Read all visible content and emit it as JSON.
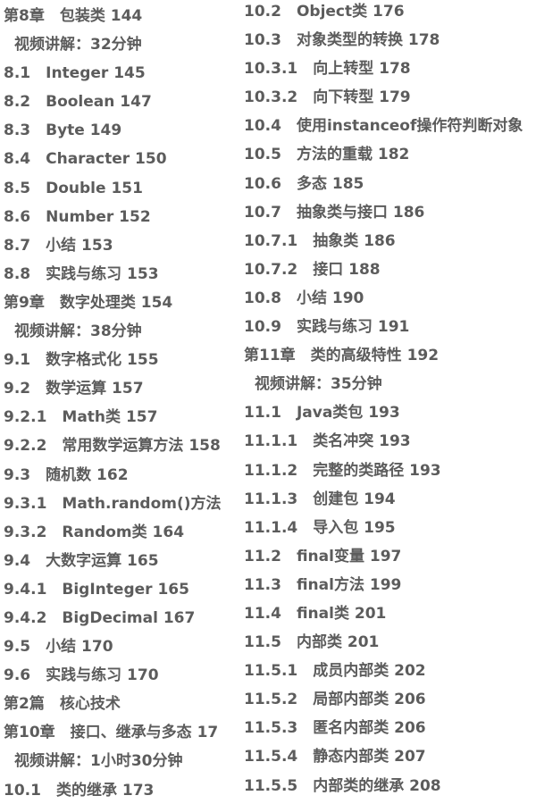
{
  "left_column": [
    {
      "text": "第8章　包装类 144",
      "indent": false
    },
    {
      "text": "视频讲解：32分钟",
      "indent": true
    },
    {
      "text": "8.1　Integer 145",
      "indent": false
    },
    {
      "text": "8.2　Boolean 147",
      "indent": false
    },
    {
      "text": "8.3　Byte 149",
      "indent": false
    },
    {
      "text": "8.4　Character 150",
      "indent": false
    },
    {
      "text": "8.5　Double 151",
      "indent": false
    },
    {
      "text": "8.6　Number 152",
      "indent": false
    },
    {
      "text": "8.7　小结 153",
      "indent": false
    },
    {
      "text": "8.8　实践与练习 153",
      "indent": false
    },
    {
      "text": "第9章　数字处理类 154",
      "indent": false
    },
    {
      "text": "视频讲解：38分钟",
      "indent": true
    },
    {
      "text": "9.1　数字格式化 155",
      "indent": false
    },
    {
      "text": "9.2　数学运算 157",
      "indent": false
    },
    {
      "text": "9.2.1　Math类 157",
      "indent": false
    },
    {
      "text": "9.2.2　常用数学运算方法 158",
      "indent": false
    },
    {
      "text": "9.3　随机数 162",
      "indent": false
    },
    {
      "text": "9.3.1　Math.random()方法",
      "indent": false
    },
    {
      "text": "9.3.2　Random类 164",
      "indent": false
    },
    {
      "text": "9.4　大数字运算 165",
      "indent": false
    },
    {
      "text": "9.4.1　BigInteger 165",
      "indent": false
    },
    {
      "text": "9.4.2　BigDecimal 167",
      "indent": false
    },
    {
      "text": "9.5　小结 170",
      "indent": false
    },
    {
      "text": "9.6　实践与练习 170",
      "indent": false
    },
    {
      "text": "第2篇　核心技术",
      "indent": false
    },
    {
      "text": "第10章　接口、继承与多态 17",
      "indent": false
    },
    {
      "text": "视频讲解：1小时30分钟",
      "indent": true
    },
    {
      "text": "10.1　类的继承 173",
      "indent": false
    }
  ],
  "right_column": [
    {
      "text": "10.2　Object类 176",
      "indent": false
    },
    {
      "text": "10.3　对象类型的转换 178",
      "indent": false
    },
    {
      "text": "10.3.1　向上转型 178",
      "indent": false
    },
    {
      "text": "10.3.2　向下转型 179",
      "indent": false
    },
    {
      "text": "10.4　使用instanceof操作符判断对象",
      "indent": false
    },
    {
      "text": "10.5　方法的重载 182",
      "indent": false
    },
    {
      "text": "10.6　多态 185",
      "indent": false
    },
    {
      "text": "10.7　抽象类与接口 186",
      "indent": false
    },
    {
      "text": "10.7.1　抽象类 186",
      "indent": false
    },
    {
      "text": "10.7.2　接口 188",
      "indent": false
    },
    {
      "text": "10.8　小结 190",
      "indent": false
    },
    {
      "text": "10.9　实践与练习 191",
      "indent": false
    },
    {
      "text": "第11章　类的高级特性 192",
      "indent": false
    },
    {
      "text": "视频讲解：35分钟",
      "indent": true
    },
    {
      "text": "11.1　Java类包 193",
      "indent": false
    },
    {
      "text": "11.1.1　类名冲突 193",
      "indent": false
    },
    {
      "text": "11.1.2　完整的类路径 193",
      "indent": false
    },
    {
      "text": "11.1.3　创建包 194",
      "indent": false
    },
    {
      "text": "11.1.4　导入包 195",
      "indent": false
    },
    {
      "text": "11.2　final变量 197",
      "indent": false
    },
    {
      "text": "11.3　final方法 199",
      "indent": false
    },
    {
      "text": "11.4　final类 201",
      "indent": false
    },
    {
      "text": "11.5　内部类 201",
      "indent": false
    },
    {
      "text": "11.5.1　成员内部类 202",
      "indent": false
    },
    {
      "text": "11.5.2　局部内部类 206",
      "indent": false
    },
    {
      "text": "11.5.3　匿名内部类 206",
      "indent": false
    },
    {
      "text": "11.5.4　静态内部类 207",
      "indent": false
    },
    {
      "text": "11.5.5　内部类的继承 208",
      "indent": false
    }
  ]
}
